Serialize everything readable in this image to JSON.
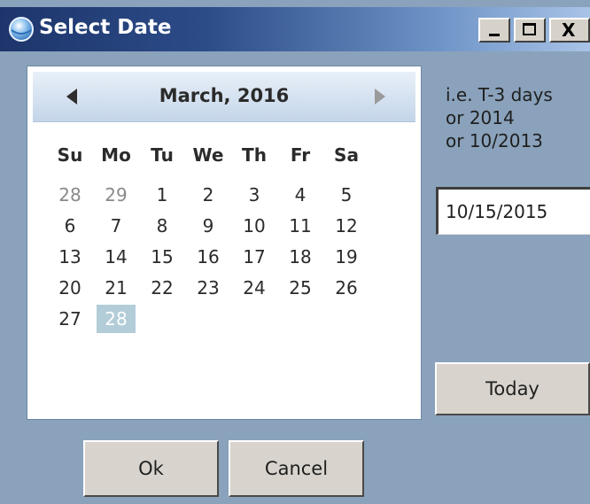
{
  "window": {
    "title": "Select Date",
    "icon": "globe-icon",
    "controls": {
      "minimize_icon": "minimize-icon",
      "maximize_icon": "maximize-icon",
      "close_label": "X"
    }
  },
  "calendar": {
    "month_label": "March, 2016",
    "prev_icon": "prev-month-arrow-icon",
    "next_icon": "next-month-arrow-icon",
    "weekdays": [
      "Su",
      "Mo",
      "Tu",
      "We",
      "Th",
      "Fr",
      "Sa"
    ],
    "weeks": [
      [
        "28",
        "29",
        "1",
        "2",
        "3",
        "4",
        "5"
      ],
      [
        "6",
        "7",
        "8",
        "9",
        "10",
        "11",
        "12"
      ],
      [
        "13",
        "14",
        "15",
        "16",
        "17",
        "18",
        "19"
      ],
      [
        "20",
        "21",
        "22",
        "23",
        "24",
        "25",
        "26"
      ],
      [
        "27",
        "28",
        "",
        "",
        "",
        "",
        ""
      ]
    ],
    "other_month_days": [
      "0-0",
      "0-1"
    ],
    "selected_day": "4-1"
  },
  "hint": {
    "line1": "i.e. T-3 days",
    "line2": "or 2014",
    "line3": "or 10/2013"
  },
  "date_input": {
    "value": "10/15/2015"
  },
  "buttons": {
    "today": "Today",
    "ok": "Ok",
    "cancel": "Cancel"
  },
  "colors": {
    "window_bg": "#8aa2bb",
    "title_bar_start": "#1d356b",
    "title_bar_end": "#a9c3e6",
    "selected_day_bg": "#b3cdd8",
    "button_face": "#d8d4cd"
  }
}
